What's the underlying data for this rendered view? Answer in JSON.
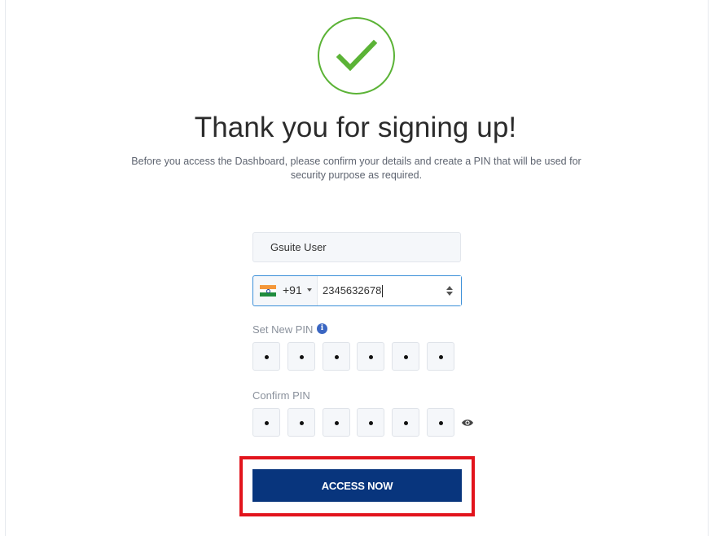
{
  "header": {
    "icon": "check-circle-icon",
    "title": "Thank you for signing up!",
    "subtitle": "Before you access the Dashboard, please confirm your details and create a PIN that will be used for security purpose as required."
  },
  "form": {
    "name_value": "Gsuite User",
    "phone": {
      "country_flag": "india-flag-icon",
      "dial_code": "+91",
      "number_value": "2345632678"
    },
    "new_pin": {
      "label": "Set New PIN",
      "info_icon": "info-icon",
      "digits": [
        "•",
        "•",
        "•",
        "•",
        "•",
        "•"
      ]
    },
    "confirm_pin": {
      "label": "Confirm PIN",
      "reveal_icon": "eye-icon",
      "digits": [
        "•",
        "•",
        "•",
        "•",
        "•",
        "•"
      ]
    },
    "submit_label": "ACCESS NOW"
  },
  "colors": {
    "success_green": "#5bb336",
    "primary_button": "#08357d",
    "highlight_red": "#e2141c",
    "focus_border": "#3b8fd8",
    "info_blue": "#3a66c2"
  }
}
